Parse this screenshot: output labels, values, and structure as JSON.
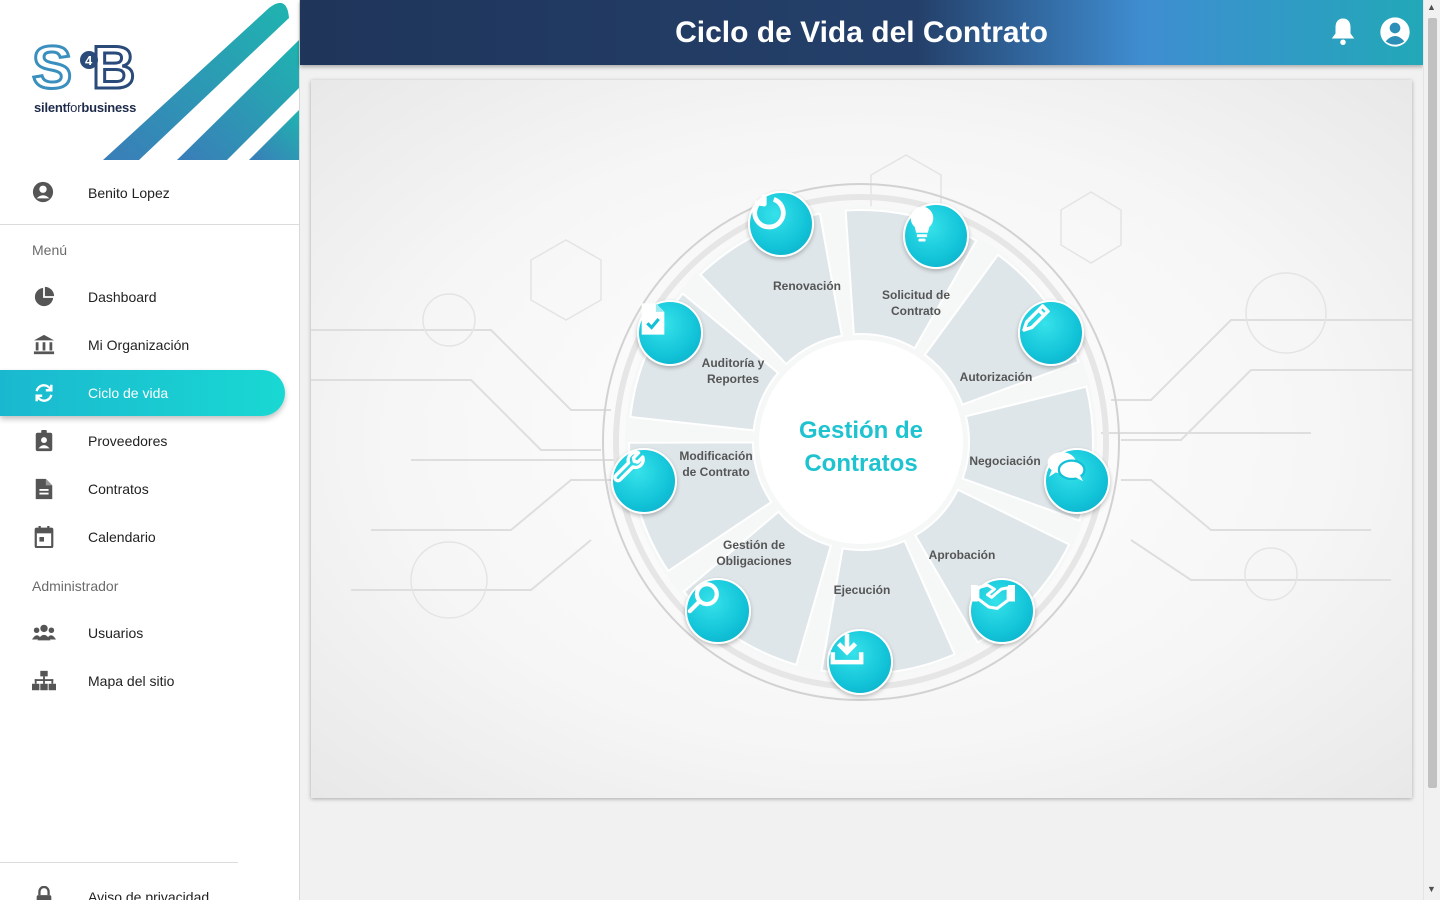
{
  "brand": {
    "logo_mark": "S4B",
    "logo_text_a": "silent",
    "logo_text_b": "for",
    "logo_text_c": "business"
  },
  "user": {
    "name": "Benito Lopez",
    "icon": "user-circle-icon"
  },
  "sections": {
    "menu": "Menú",
    "admin": "Administrador"
  },
  "nav": [
    {
      "label": "Dashboard",
      "icon": "pie-chart-icon"
    },
    {
      "label": "Mi Organización",
      "icon": "bank-icon"
    },
    {
      "label": "Ciclo de vida",
      "icon": "sync-icon"
    },
    {
      "label": "Proveedores",
      "icon": "id-badge-icon"
    },
    {
      "label": "Contratos",
      "icon": "document-icon"
    },
    {
      "label": "Calendario",
      "icon": "calendar-icon"
    }
  ],
  "admin_nav": [
    {
      "label": "Usuarios",
      "icon": "users-icon"
    },
    {
      "label": "Mapa del sitio",
      "icon": "sitemap-icon"
    }
  ],
  "footer_nav": {
    "label": "Aviso de privacidad",
    "icon": "lock-icon"
  },
  "header": {
    "title": "Ciclo de Vida del Contrato"
  },
  "diagram": {
    "center_line1": "Gestión de",
    "center_line2": "Contratos",
    "stages": {
      "renovacion": "Renovación",
      "solicitud": "Solicitud de\nContrato",
      "autorizacion": "Autorización",
      "negociacion": "Negociación",
      "aprobacion": "Aprobación",
      "ejecucion": "Ejecución",
      "obligaciones": "Gestión de\nObligaciones",
      "modificacion": "Modificación\nde Contrato",
      "auditoria": "Auditoría y\nReportes"
    }
  },
  "colors": {
    "accent": "#19c9d6",
    "header_dark": "#1f355a",
    "sidebar_active": "#1ab8cf"
  }
}
